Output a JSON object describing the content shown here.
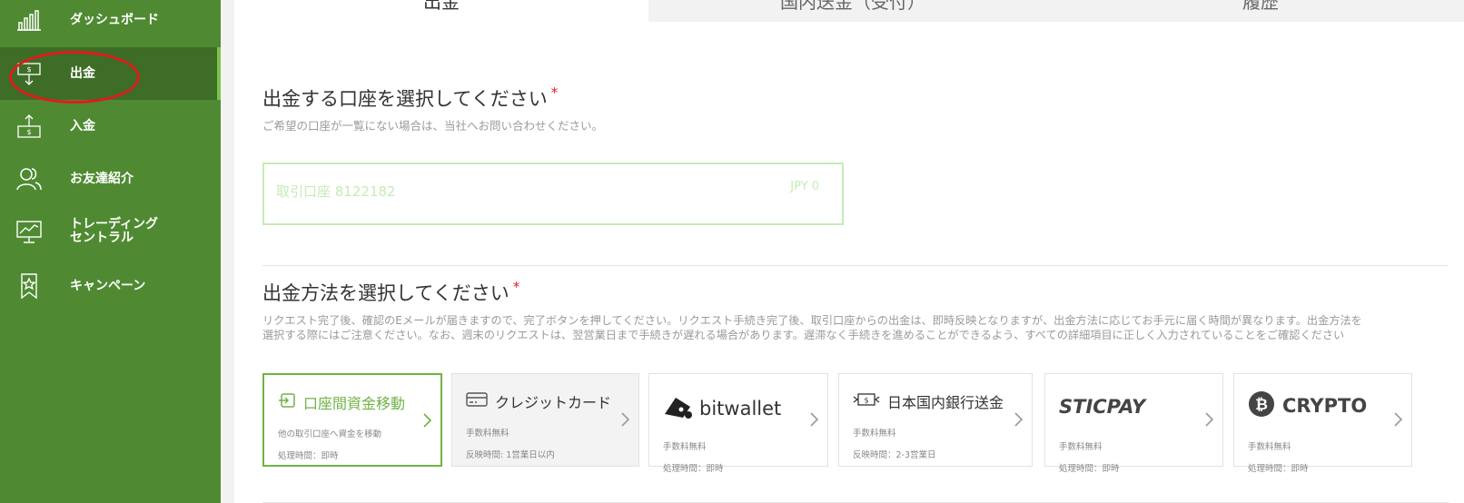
{
  "sidebar": {
    "items": [
      {
        "label": "ダッシュボード",
        "icon": "bar-chart-icon"
      },
      {
        "label": "出金",
        "icon": "withdraw-icon"
      },
      {
        "label": "入金",
        "icon": "deposit-icon"
      },
      {
        "label": "お友達紹介",
        "icon": "referral-users-icon"
      },
      {
        "label": "トレーディング\nセントラル",
        "icon": "trading-monitor-icon"
      },
      {
        "label": "キャンペーン",
        "icon": "campaign-badge-icon"
      }
    ]
  },
  "tabs": [
    {
      "label": "出金"
    },
    {
      "label": "国内送金（受付）"
    },
    {
      "label": "履歴"
    }
  ],
  "account_section": {
    "title": "出金する口座を選択してください",
    "required_mark": "*",
    "desc": "ご希望の口座が一覧にない場合は、当社へお問い合わせください。",
    "account_name": "取引口座 8122182",
    "account_balance": "JPY 0"
  },
  "method_section": {
    "title": "出金方法を選択してください",
    "required_mark": "*",
    "desc_line1": "リクエスト完了後、確認のEメールが届きますので、完了ボタンを押してください。リクエスト手続き完了後、取引口座からの出金は、即時反映となりますが、出金方法に応じてお手元に届く時間が異なります。出金方法を",
    "desc_line2": "選択する際にはご注意ください。なお、週末のリクエストは、翌営業日まで手続きが遅れる場合があります。遅滞なく手続きを進めることができるよう、すべての詳細項目に正しく入力されていることをご確認ください",
    "methods": [
      {
        "title": "口座間資金移動",
        "line1": "他の取引口座へ資金を移動",
        "line2": "処理時間：即時",
        "icon": "transfer-icon"
      },
      {
        "title": "クレジットカード",
        "line1": "手数料無料",
        "line2": "反映時間: 1営業日以内",
        "icon": "credit-card-icon"
      },
      {
        "title": "bitwallet",
        "line1": "手数料無料",
        "line2": "処理時間：即時",
        "icon": "bitwallet-logo-icon"
      },
      {
        "title": "日本国内銀行送金",
        "line1": "手数料無料",
        "line2": "反映時間：2-3営業日",
        "icon": "bank-transfer-icon"
      },
      {
        "title": "STICPAY",
        "line1": "手数料無料",
        "line2": "処理時間：即時",
        "icon": "sticpay-logo-icon"
      },
      {
        "title": "CRYPTO",
        "line1": "手数料無料",
        "line2": "処理時間：即時",
        "icon": "bitcoin-icon"
      }
    ]
  },
  "colors": {
    "sidebar_bg": "#4f8a32",
    "sidebar_active": "#3e6d27",
    "accent_green": "#6fb346",
    "annotation_red": "#e01b1b"
  }
}
